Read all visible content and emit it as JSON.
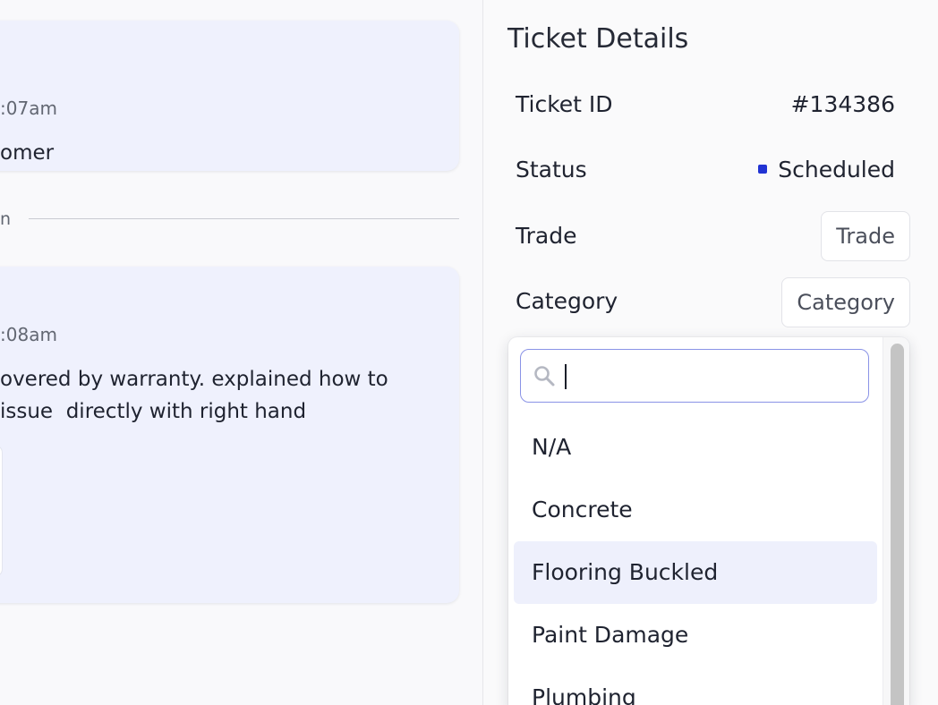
{
  "chat": {
    "messages": [
      {
        "time": ":07am",
        "body": "omer"
      },
      {
        "time": ":08am",
        "body": "overed by warranty. explained how to\nissue  directly with right hand"
      }
    ],
    "divider_label": "n"
  },
  "details": {
    "title": "Ticket Details",
    "rows": {
      "ticket_id": {
        "label": "Ticket ID",
        "value": "#134386"
      },
      "status": {
        "label": "Status",
        "value": "Scheduled",
        "color": "#2133d3"
      },
      "trade": {
        "label": "Trade",
        "value": "Trade"
      },
      "category": {
        "label": "Category",
        "value": "Category"
      }
    }
  },
  "dropdown": {
    "search_value": "",
    "search_icon": "search-icon",
    "options": [
      "N/A",
      "Concrete",
      "Flooring Buckled",
      "Paint Damage",
      "Plumbing"
    ],
    "highlighted": "Flooring Buckled"
  },
  "colors": {
    "accent": "#2133d3",
    "card_bg": "#eff1fd",
    "highlight_bg": "#eef0fc"
  }
}
